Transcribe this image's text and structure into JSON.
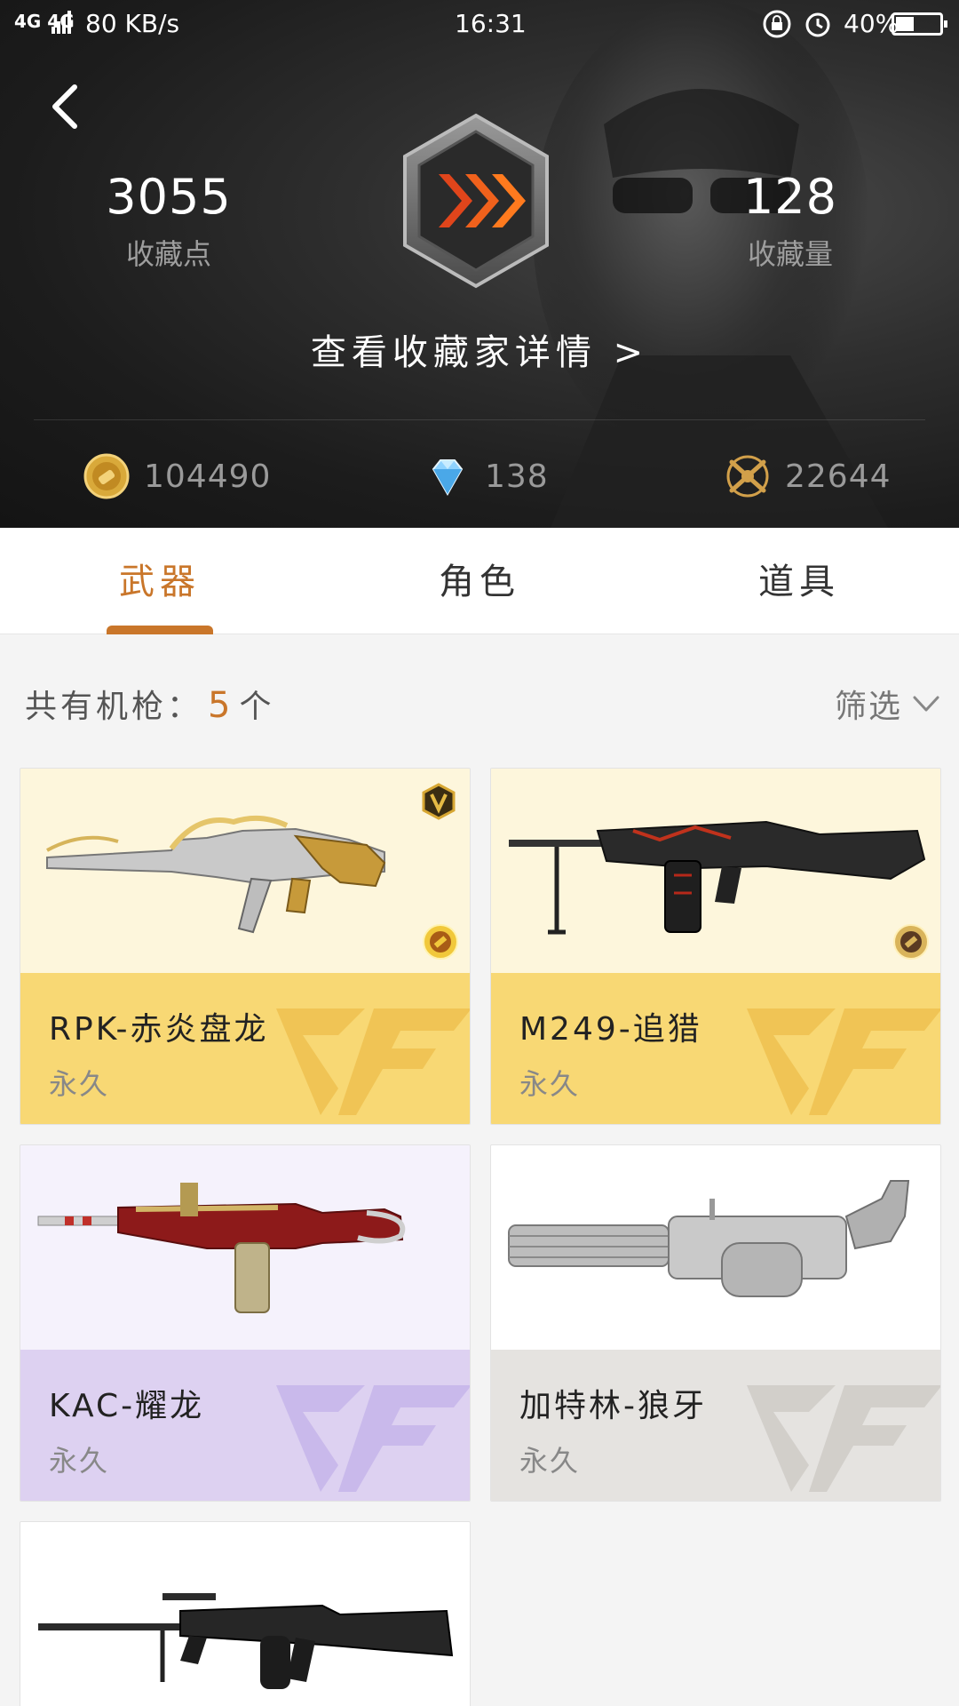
{
  "status_bar": {
    "signal": "4G 4G",
    "speed": "80 KB/s",
    "time": "16:31",
    "battery": "40%"
  },
  "header": {
    "left_stat": {
      "value": "3055",
      "label": "收藏点"
    },
    "right_stat": {
      "value": "128",
      "label": "收藏量"
    },
    "details_link": "查看收藏家详情 >",
    "currencies": [
      {
        "icon": "gold-coin-icon",
        "value": "104490"
      },
      {
        "icon": "diamond-icon",
        "value": "138"
      },
      {
        "icon": "crossed-guns-icon",
        "value": "22644"
      }
    ]
  },
  "tabs": [
    {
      "label": "武器",
      "active": true
    },
    {
      "label": "角色",
      "active": false
    },
    {
      "label": "道具",
      "active": false
    }
  ],
  "filter": {
    "count_prefix": "共有机枪：",
    "count": "5",
    "count_suffix": "个",
    "filter_label": "筛选"
  },
  "cards": [
    {
      "name": "RPK-赤炎盘龙",
      "duration": "永久",
      "theme": "yellow",
      "badges": [
        "v-badge-icon",
        "coin-badge-icon"
      ]
    },
    {
      "name": "M249-追猎",
      "duration": "永久",
      "theme": "yellow",
      "badges": [
        "coin-badge-icon"
      ]
    },
    {
      "name": "KAC-耀龙",
      "duration": "永久",
      "theme": "purple",
      "badges": []
    },
    {
      "name": "加特林-狼牙",
      "duration": "永久",
      "theme": "grey",
      "badges": []
    }
  ],
  "colors": {
    "accent": "#c9762a",
    "yellow_info": "#f8d874",
    "purple_info": "#ddd1f1",
    "grey_info": "#e5e3e0"
  }
}
